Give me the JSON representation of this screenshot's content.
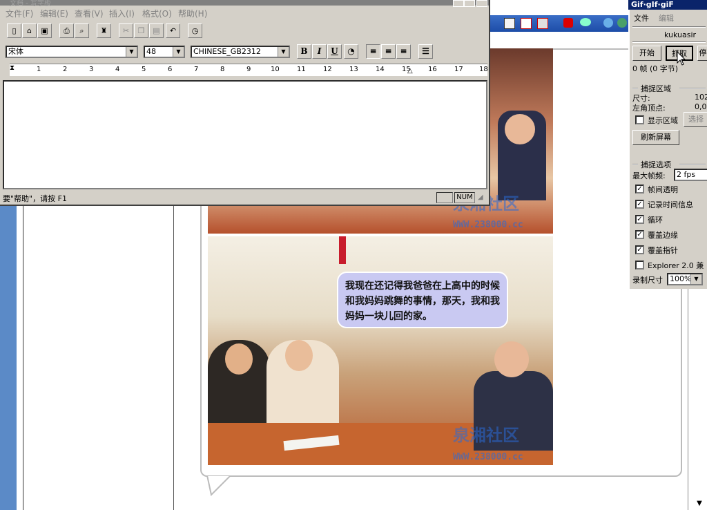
{
  "wordpad": {
    "title": "文档 - 写字板",
    "menu": [
      "文件(F)",
      "编辑(E)",
      "查看(V)",
      "插入(I)",
      "格式(O)",
      "帮助(H)"
    ],
    "font_name": "宋体",
    "font_size": "48",
    "charset": "CHINESE_GB2312",
    "format_buttons": {
      "bold": "B",
      "italic": "I",
      "underline": "U"
    },
    "ruler_numbers": [
      "1",
      "2",
      "3",
      "4",
      "5",
      "6",
      "7",
      "8",
      "9",
      "10",
      "11",
      "12",
      "13",
      "14",
      "15",
      "16",
      "17",
      "18"
    ],
    "status_text": "要\"帮助\"，请按 F1",
    "status_num": "NUM"
  },
  "gif_app": {
    "title": "Gif·gIf·giF",
    "menu": [
      "文件",
      "编辑"
    ],
    "user": "kukuasir",
    "buttons": {
      "start": "开始",
      "capture": "抓取",
      "other": "停"
    },
    "frames_info": "0 帧 (0 字节)",
    "capture_region": {
      "header": "捕捉区域",
      "size_label": "尺寸:",
      "size_value": "102",
      "corner_label": "左角顶点:",
      "corner_value": "0,0",
      "show_region": "显示区域",
      "select_button": "选择",
      "refresh_button": "刷新屏幕"
    },
    "capture_options": {
      "header": "捕捉选项",
      "max_fps_label": "最大帧频:",
      "max_fps_value": "2 fps",
      "options": [
        {
          "label": "帧间透明",
          "checked": true
        },
        {
          "label": "记录时间信息",
          "checked": true
        },
        {
          "label": "循环",
          "checked": true
        },
        {
          "label": "覆盖边缘",
          "checked": true
        },
        {
          "label": "覆盖指针",
          "checked": true
        },
        {
          "label": "Explorer 2.0 兼",
          "checked": false
        }
      ],
      "record_size_label": "录制尺寸",
      "record_size_value": "100%"
    }
  },
  "page": {
    "speech_bubble": "我现在还记得我爸爸在上高中的时候和我妈妈跳舞的事情，那天，我和我妈妈一块儿回的家。",
    "watermark": "泉湘社区",
    "watermark_url": "WWW.238000.cc"
  }
}
